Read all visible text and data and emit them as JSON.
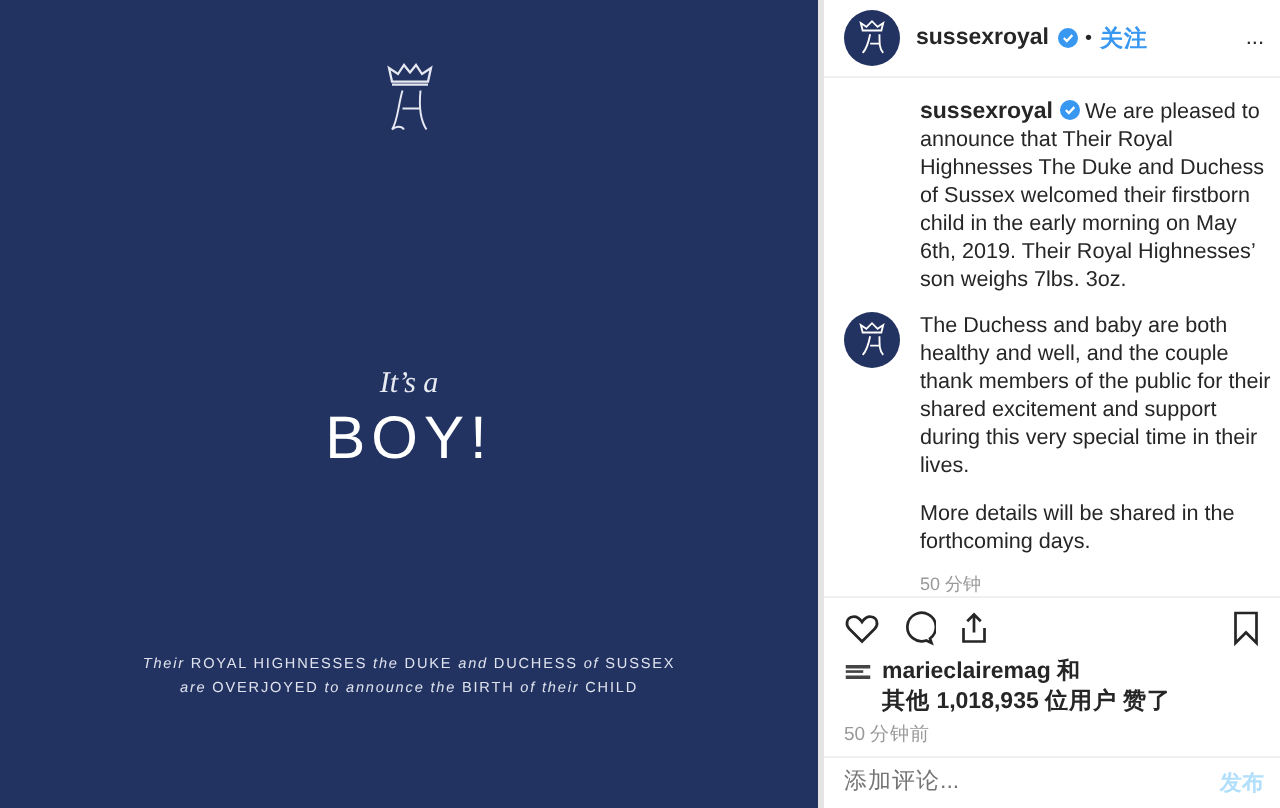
{
  "post_image": {
    "kicker": "It’s a",
    "headline": "BOY!",
    "lines": [
      "*Their* ROYAL HIGHNESSES *the* DUKE *and* DUCHESS *of* SUSSEX",
      "*are* OVERJOYED *to announce the* BIRTH *of their* CHILD"
    ]
  },
  "header": {
    "username": "sussexroyal",
    "verified": true,
    "separator": "•",
    "follow": "关注",
    "more": "..."
  },
  "comments": [
    {
      "kind": "caption",
      "username": "sussexroyal",
      "verified": true,
      "paragraphs": [
        "We are pleased to announce that Their Royal Highnesses The Duke and Duchess of Sussex welcomed their firstborn child in the early morning on May 6th, 2019. Their Royal Highnesses’ son weighs 7lbs. 3oz."
      ]
    },
    {
      "kind": "comment",
      "paragraphs": [
        "The Duchess and baby are both healthy and well, and the couple thank members of the public for their shared excitement and support during this very special time in their lives.",
        "More details will be shared in the forthcoming days."
      ]
    }
  ],
  "comment_time": "50 分钟",
  "likes": {
    "user": "marieclairemag",
    "joiner": "和",
    "others": "其他 1,018,935 位用户 赞了"
  },
  "post_time": "50 分钟前",
  "comment_box": {
    "placeholder": "添加评论...",
    "post_button": "发布",
    "disabled": true
  }
}
